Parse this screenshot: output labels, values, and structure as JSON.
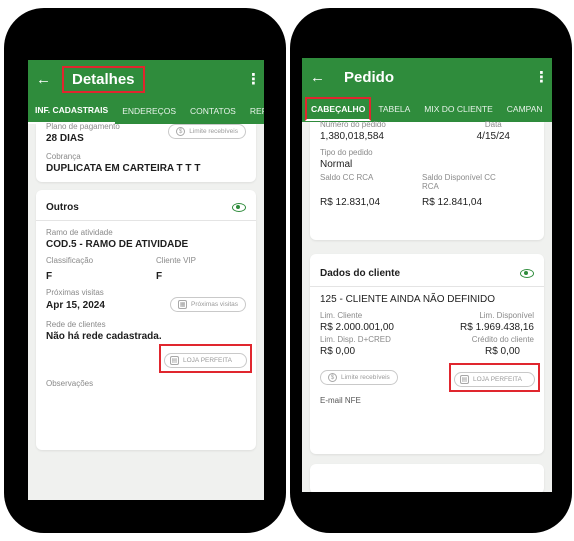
{
  "left": {
    "appbar": {
      "title": "Detalhes",
      "back_icon": "arrow-left-icon",
      "menu_icon": "kebab-icon"
    },
    "tabs": [
      "INF. CADASTRAIS",
      "ENDEREÇOS",
      "CONTATOS",
      "REF. C"
    ],
    "payment": {
      "label": "Plano de pagamento",
      "value": "28 DIAS",
      "button": "Limite recebíveis"
    },
    "billing": {
      "label": "Cobrança",
      "value": "DUPLICATA EM CARTEIRA T T T"
    },
    "outros": {
      "title": "Outros",
      "activity_label": "Ramo de atividade",
      "activity_value": "COD.5 - RAMO DE ATIVIDADE",
      "class_label": "Classificação",
      "class_value": "F",
      "vip_label": "Cliente VIP",
      "vip_value": "F",
      "visits_label": "Próximas visitas",
      "visits_value": "Apr 15, 2024",
      "visits_button": "Próximas visitas",
      "network_label": "Rede de clientes",
      "network_value": "Não há rede cadastrada.",
      "store_button": "LOJA PERFEITA",
      "notes_label": "Observações"
    }
  },
  "right": {
    "appbar": {
      "title": "Pedido",
      "back_icon": "arrow-left-icon",
      "menu_icon": "kebab-icon"
    },
    "tabs": [
      "CABEÇALHO",
      "TABELA",
      "MIX DO CLIENTE",
      "CAMPAN"
    ],
    "order": {
      "number_label": "Número do pedido",
      "number_value": "1,380,018,584",
      "date_label": "Data",
      "date_value": "4/15/24",
      "type_label": "Tipo do pedido",
      "type_value": "Normal",
      "cc_label": "Saldo CC RCA",
      "cc_value": "R$ 12.831,04",
      "cc_avail_label": "Saldo Disponível CC RCA",
      "cc_avail_value": "R$ 12.841,04"
    },
    "client": {
      "title": "Dados do cliente",
      "name": "125 - CLIENTE AINDA NÃO DEFINIDO",
      "limit_label": "Lim. Cliente",
      "limit_value": "R$ 2.000.001,00",
      "avail_label": "Lim. Disponível",
      "avail_value": "R$ 1.969.438,16",
      "disp_label": "Lim. Disp. D+CRED",
      "disp_value": "R$ 0,00",
      "credit_label": "Crédito do cliente",
      "credit_value": "R$ 0,00",
      "limit_button": "Limite recebíveis",
      "store_button": "LOJA PERFEITA",
      "email_label": "E-mail NFE"
    }
  }
}
